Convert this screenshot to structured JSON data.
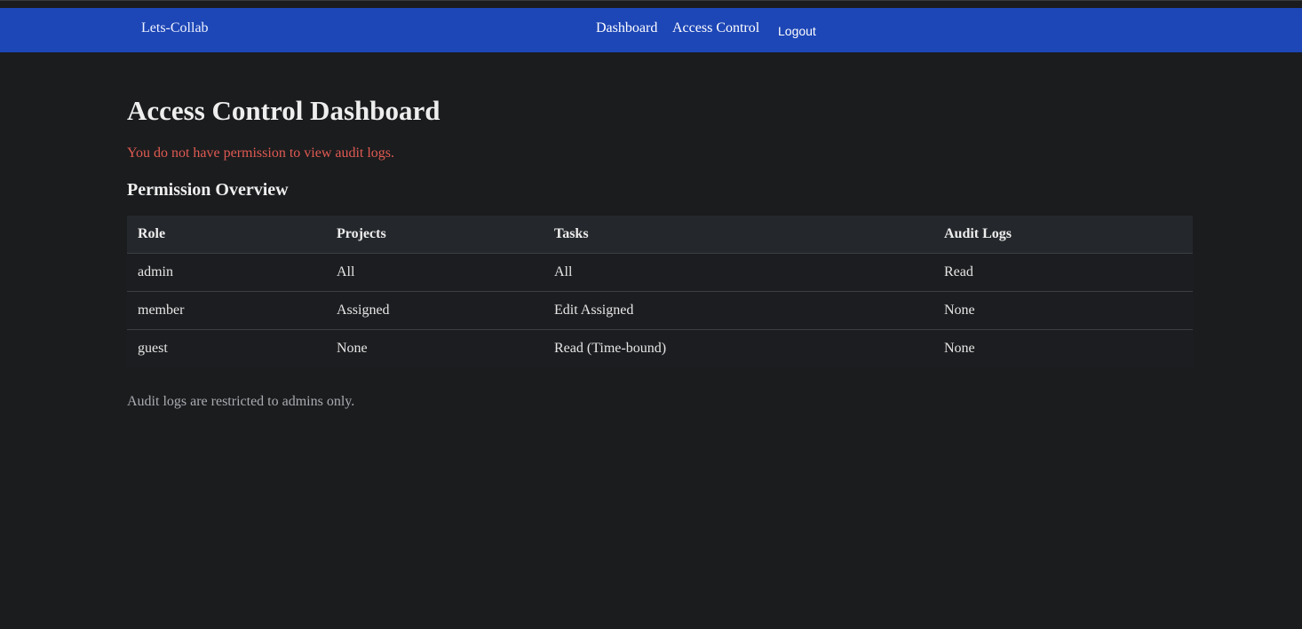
{
  "navbar": {
    "brand": "Lets-Collab",
    "links": [
      "Dashboard",
      "Access Control"
    ],
    "logout_label": "Logout"
  },
  "main": {
    "title": "Access Control Dashboard",
    "error_message": "You do not have permission to view audit logs.",
    "section_title": "Permission Overview",
    "table": {
      "headers": [
        "Role",
        "Projects",
        "Tasks",
        "Audit Logs"
      ],
      "rows": [
        [
          "admin",
          "All",
          "All",
          "Read"
        ],
        [
          "member",
          "Assigned",
          "Edit Assigned",
          "None"
        ],
        [
          "guest",
          "None",
          "Read (Time-bound)",
          "None"
        ]
      ]
    },
    "footer_note": "Audit logs are restricted to admins only."
  },
  "colors": {
    "navbar_bg": "#1d46b6",
    "page_bg": "#1b1c1e",
    "error_text": "#e05a52",
    "table_header_bg": "#24272b"
  }
}
